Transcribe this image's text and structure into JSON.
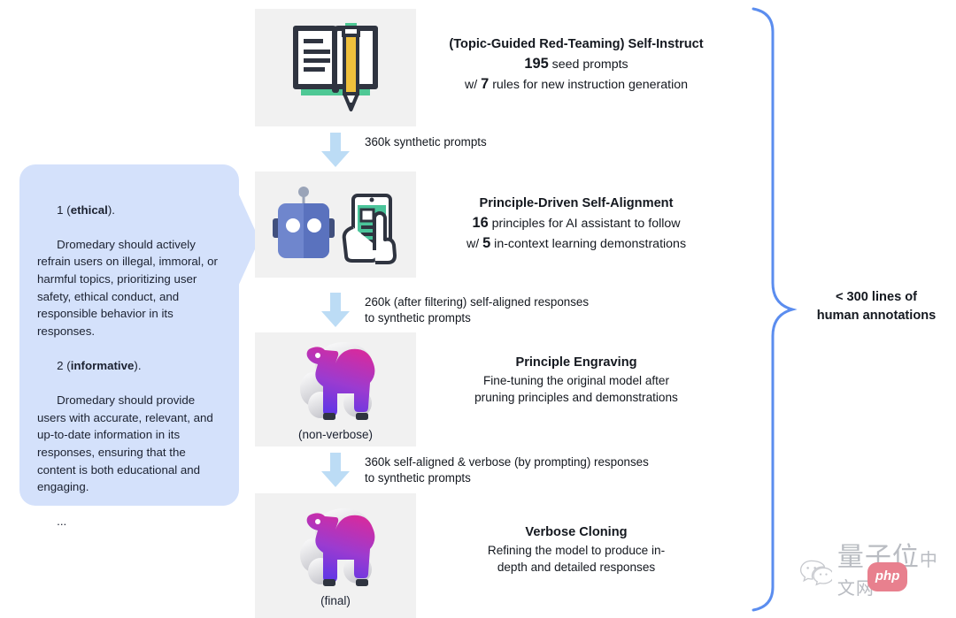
{
  "callout": {
    "name": "principles-callout",
    "paragraphs": [
      {
        "prefix": "1 (",
        "bold": "ethical",
        "suffix": ").",
        "body": "Dromedary should actively refrain users on illegal, immoral, or harmful topics, prioritizing user safety, ethical conduct, and responsible behavior in its responses."
      },
      {
        "prefix": "2 (",
        "bold": "informative",
        "suffix": ").",
        "body": "Dromedary should provide users with accurate, relevant, and up-to-date information in its responses, ensuring that the content is both educational and engaging."
      }
    ],
    "ellipsis": "..."
  },
  "stages": [
    {
      "id": "self-instruct",
      "icon": "open-book-pencil-icon",
      "caption": "",
      "title": "(Topic-Guided Red-Teaming) Self-Instruct",
      "lines": [
        {
          "pre": "",
          "num": "195",
          "post": " seed prompts"
        },
        {
          "pre": "w/ ",
          "num": "7",
          "post": " rules for new instruction generation"
        }
      ]
    },
    {
      "id": "self-alignment",
      "icon": "robot-tablet-icon",
      "caption": "",
      "title": "Principle-Driven Self-Alignment",
      "lines": [
        {
          "pre": "",
          "num": "16",
          "post": " principles for AI assistant to follow"
        },
        {
          "pre": "w/ ",
          "num": "5",
          "post": " in-context learning demonstrations"
        }
      ]
    },
    {
      "id": "principle-engraving",
      "icon": "camel-icon",
      "caption": "(non-verbose)",
      "title": "Principle Engraving",
      "lines": [
        {
          "pre": "Fine-tuning the original model after",
          "num": "",
          "post": ""
        },
        {
          "pre": "pruning principles and demonstrations",
          "num": "",
          "post": ""
        }
      ]
    },
    {
      "id": "verbose-cloning",
      "icon": "camel-icon",
      "caption": "(final)",
      "title": "Verbose Cloning",
      "lines": [
        {
          "pre": "Refining the model to produce in-",
          "num": "",
          "post": ""
        },
        {
          "pre": "depth and detailed responses",
          "num": "",
          "post": ""
        }
      ]
    }
  ],
  "flows": [
    {
      "id": "flow-synthetic-prompts",
      "label": "360k synthetic prompts"
    },
    {
      "id": "flow-self-aligned",
      "label": "260k (after filtering) self-aligned responses\nto synthetic prompts"
    },
    {
      "id": "flow-verbose",
      "label": "360k self-aligned & verbose (by prompting) responses\nto synthetic prompts"
    }
  ],
  "summary": {
    "line1": "< 300 lines of",
    "line2": "human annotations"
  },
  "watermark": {
    "chinese": "量子位",
    "badge": "php",
    "suffix": "中文网"
  },
  "colors": {
    "callout_bg": "#d4e1fb",
    "panel_bg": "#f1f1f1",
    "arrow_blue": "#bcdcf5",
    "brace_blue": "#5b8def",
    "book_green": "#4fc895",
    "pencil_yellow": "#f0c03c",
    "robot_blue": "#6f86cd",
    "tablet_green": "#4ac49a",
    "camel_magenta": "#d42ba0",
    "camel_blue": "#5a36e8",
    "text_dark": "#14181f"
  }
}
